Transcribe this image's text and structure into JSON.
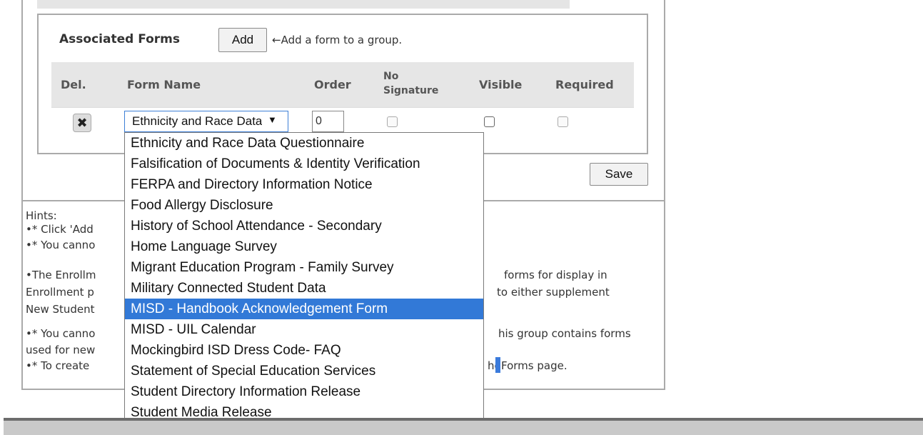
{
  "forms_section": {
    "title": "Associated Forms",
    "add_button": "Add",
    "add_hint": "←Add a form to a group."
  },
  "table": {
    "headers": {
      "del": "Del.",
      "form_name": "Form Name",
      "order": "Order",
      "no_signature_line1": "No",
      "no_signature_line2": "Signature",
      "visible": "Visible",
      "required": "Required"
    },
    "row": {
      "selected_form": "Ethnicity and Race Data Questionnaire",
      "order_value": "0",
      "no_signature": false,
      "visible": false,
      "required": false
    }
  },
  "dropdown": {
    "options": [
      "Ethnicity and Race Data Questionnaire",
      "Falsification of Documents & Identity Verification",
      "FERPA and Directory Information Notice",
      "Food Allergy Disclosure",
      "History of School Attendance - Secondary",
      "Home Language Survey",
      "Migrant Education Program - Family Survey",
      "Military Connected Student Data",
      "MISD - Handbook Acknowledgement Form",
      "MISD - UIL Calendar",
      "Mockingbird ISD Dress Code- FAQ",
      "Statement of Special Education Services",
      "Student Directory Information Release",
      "Student Media Release"
    ],
    "highlighted_option": "MISD - Handbook Acknowledgement Form"
  },
  "save_button": "Save",
  "hints": {
    "title": "Hints:",
    "line1": "•* Click 'Add",
    "line2": "•* You canno",
    "line3_left": "•The Enrollm",
    "line3_right": "forms for display in",
    "line4_left": "Enrollment p",
    "line4_right": "to either supplement",
    "line5_left": "New Student",
    "line6_left": "•* You canno",
    "line6_right": "his group contains forms",
    "line7_left": "used for new",
    "line8_left": "•* To create",
    "line8_right_a": "he",
    "line8_right_b": "Forms page."
  }
}
